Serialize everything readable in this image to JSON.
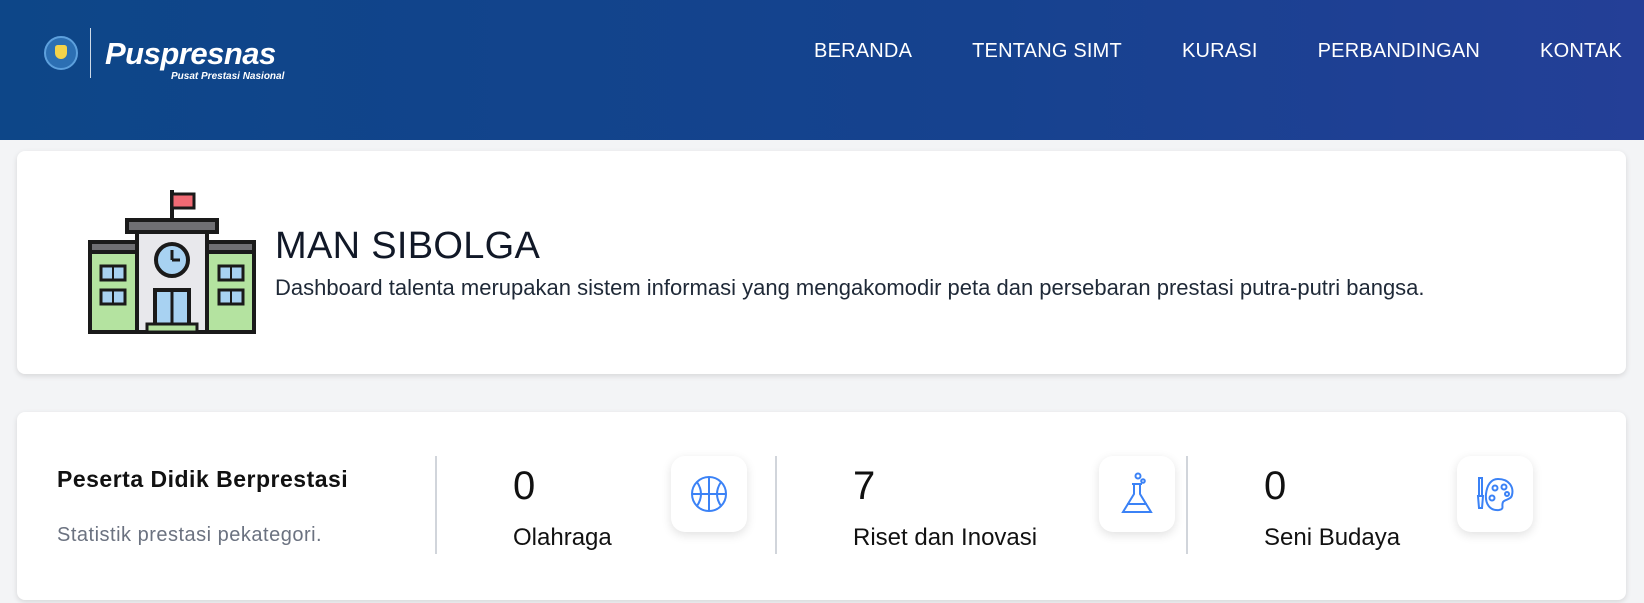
{
  "header": {
    "brand": {
      "name": "Puspresnas",
      "tagline": "Pusat Prestasi Nasional"
    },
    "nav": [
      {
        "label": "BERANDA"
      },
      {
        "label": "TENTANG SIMT"
      },
      {
        "label": "KURASI"
      },
      {
        "label": "PERBANDINGAN"
      },
      {
        "label": "KONTAK"
      }
    ]
  },
  "school": {
    "icon": "school-building-icon",
    "name": "MAN SIBOLGA",
    "description": "Dashboard talenta merupakan sistem informasi yang mengakomodir peta dan persebaran prestasi putra-putri bangsa."
  },
  "stats": {
    "title": "Peserta Didik Berprestasi",
    "subtitle": "Statistik prestasi pekategori.",
    "items": [
      {
        "value": "0",
        "label": "Olahraga",
        "icon": "basketball-icon"
      },
      {
        "value": "7",
        "label": "Riset dan Inovasi",
        "icon": "flask-icon"
      },
      {
        "value": "0",
        "label": "Seni Budaya",
        "icon": "palette-icon"
      }
    ]
  },
  "colors": {
    "header_start": "#0d4688",
    "header_end": "#243f97",
    "icon_accent": "#3b82f6"
  }
}
